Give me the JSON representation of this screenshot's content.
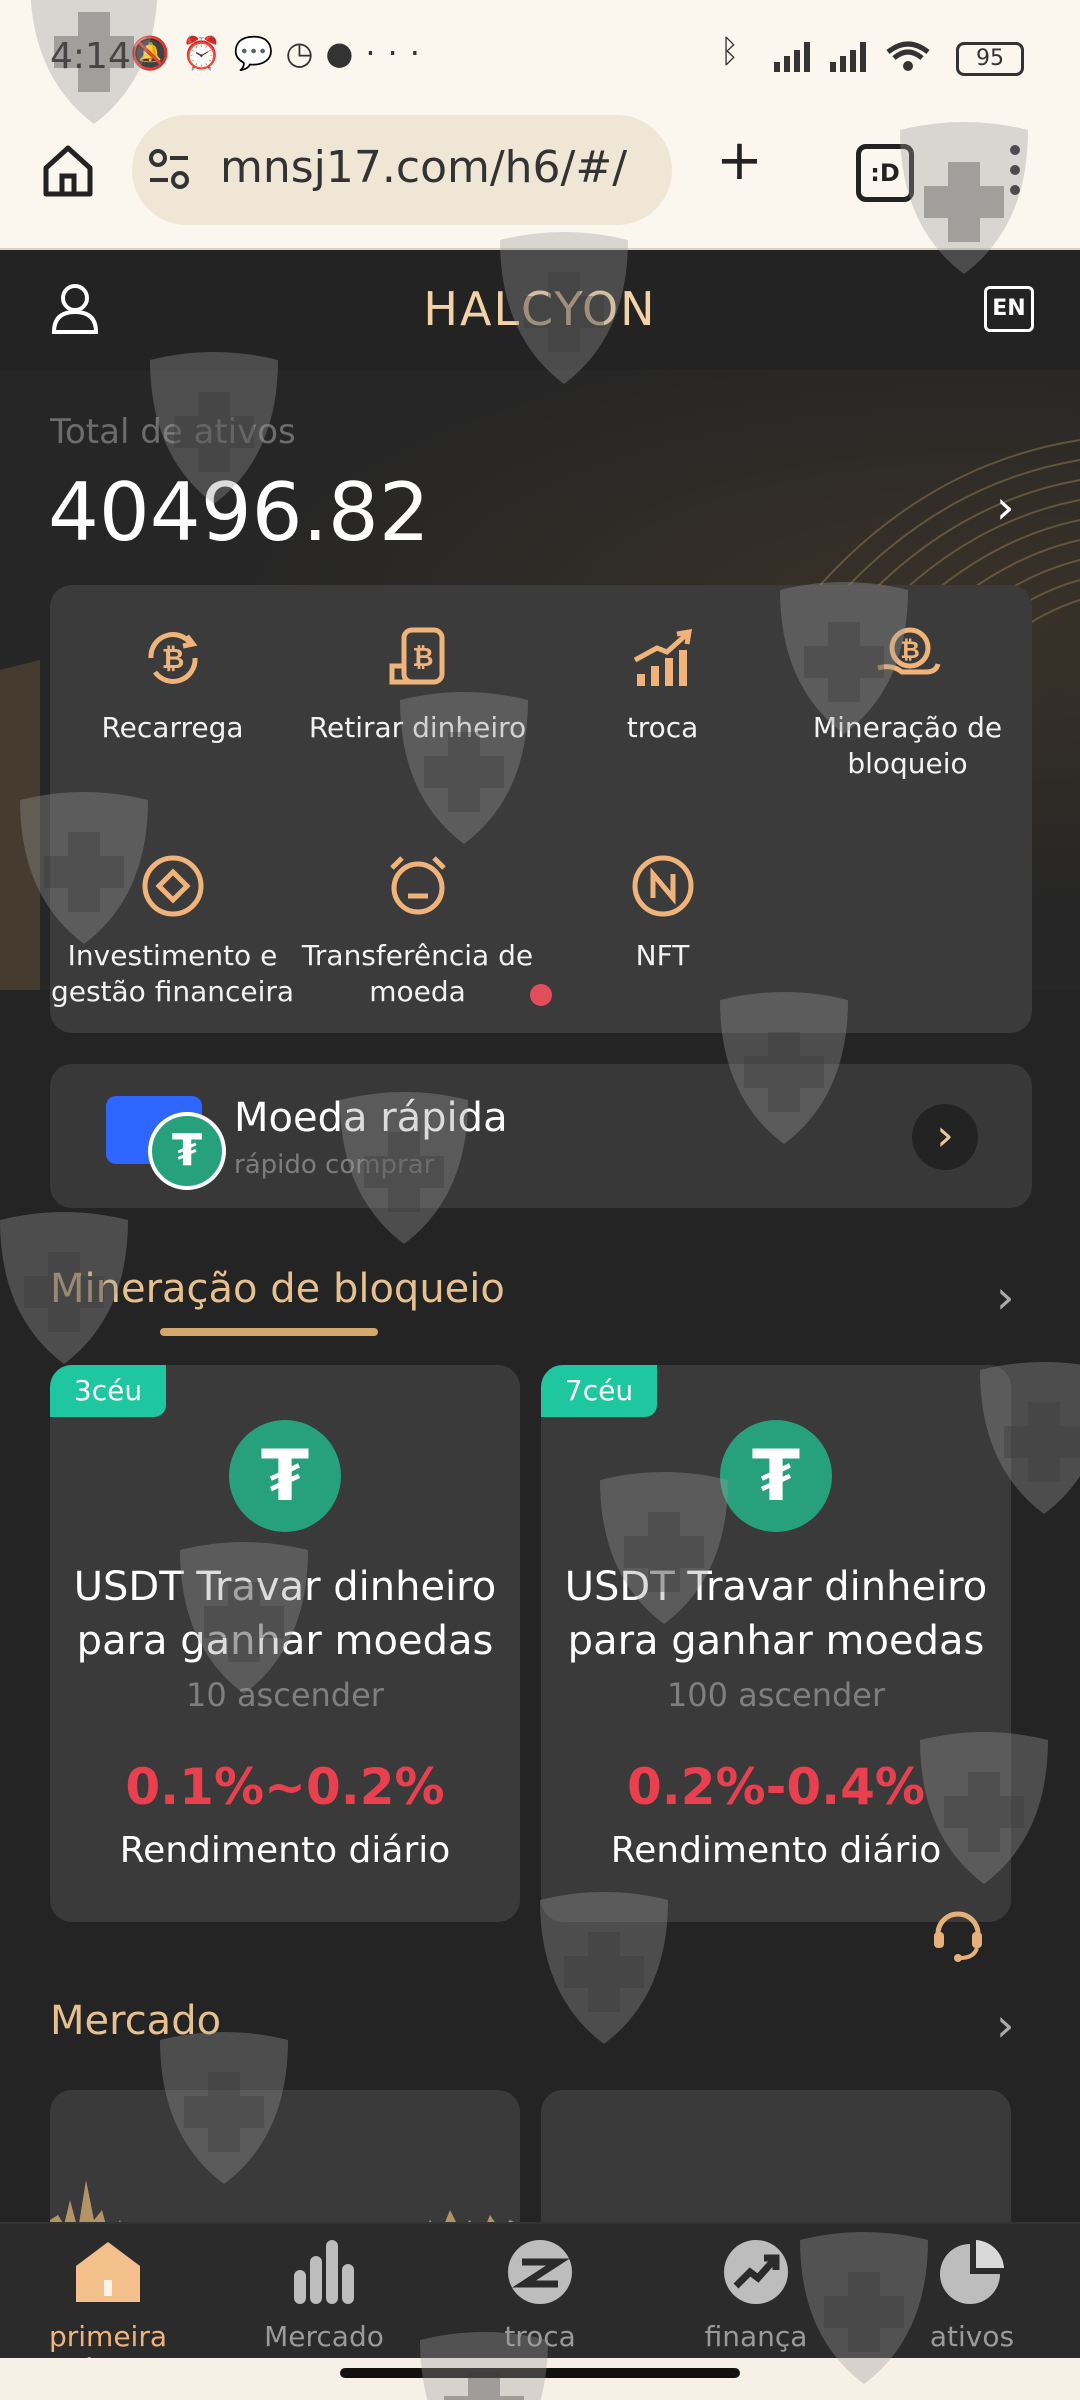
{
  "status": {
    "time": "4:14",
    "battery": "95",
    "more": "···"
  },
  "browser": {
    "url": "mnsj17.com/h6/#/",
    "tabs_label": ":D"
  },
  "header": {
    "title": "HALCYON",
    "lang": "EN"
  },
  "assets": {
    "label": "Total de ativos",
    "value": "40496.82"
  },
  "actions": [
    {
      "label": "Recarrega",
      "icon": "bitcoin-refresh-icon"
    },
    {
      "label": "Retirar dinheiro",
      "icon": "bitcoin-withdraw-icon"
    },
    {
      "label": "troca",
      "icon": "trend-chart-icon"
    },
    {
      "label": "Mineração de bloqueio",
      "icon": "bitcoin-hand-icon"
    },
    {
      "label": "Investimento e gestão financeira",
      "icon": "investment-icon"
    },
    {
      "label": "Transferência de moeda",
      "icon": "alarm-transfer-icon"
    },
    {
      "label": "NFT",
      "icon": "nft-icon"
    }
  ],
  "quick": {
    "title": "Moeda rápida",
    "subtitle": "rápido comprar"
  },
  "mining": {
    "title": "Mineração de bloqueio",
    "cards": [
      {
        "tag": "3céu",
        "name": "USDT Travar dinheiro para ganhar moedas",
        "level": "10 ascender",
        "rate": "0.1%~0.2%",
        "daily": "Rendimento diário"
      },
      {
        "tag": "7céu",
        "name": "USDT Travar dinheiro para ganhar moedas",
        "level": "100 ascender",
        "rate": "0.2%-0.4%",
        "daily": "Rendimento diário"
      }
    ]
  },
  "market": {
    "title": "Mercado"
  },
  "nav": [
    {
      "label": "primeira página",
      "icon": "home-icon",
      "active": true
    },
    {
      "label": "Mercado",
      "icon": "bar-chart-icon",
      "active": false
    },
    {
      "label": "troca",
      "icon": "exchange-icon",
      "active": false
    },
    {
      "label": "finança",
      "icon": "finance-icon",
      "active": false
    },
    {
      "label": "ativos",
      "icon": "pie-chart-icon",
      "active": false
    }
  ],
  "colors": {
    "accent": "#e6c08f",
    "rate_red": "#e8404f",
    "tag_green": "#1fc7a1",
    "tether_green": "#26a17b"
  }
}
